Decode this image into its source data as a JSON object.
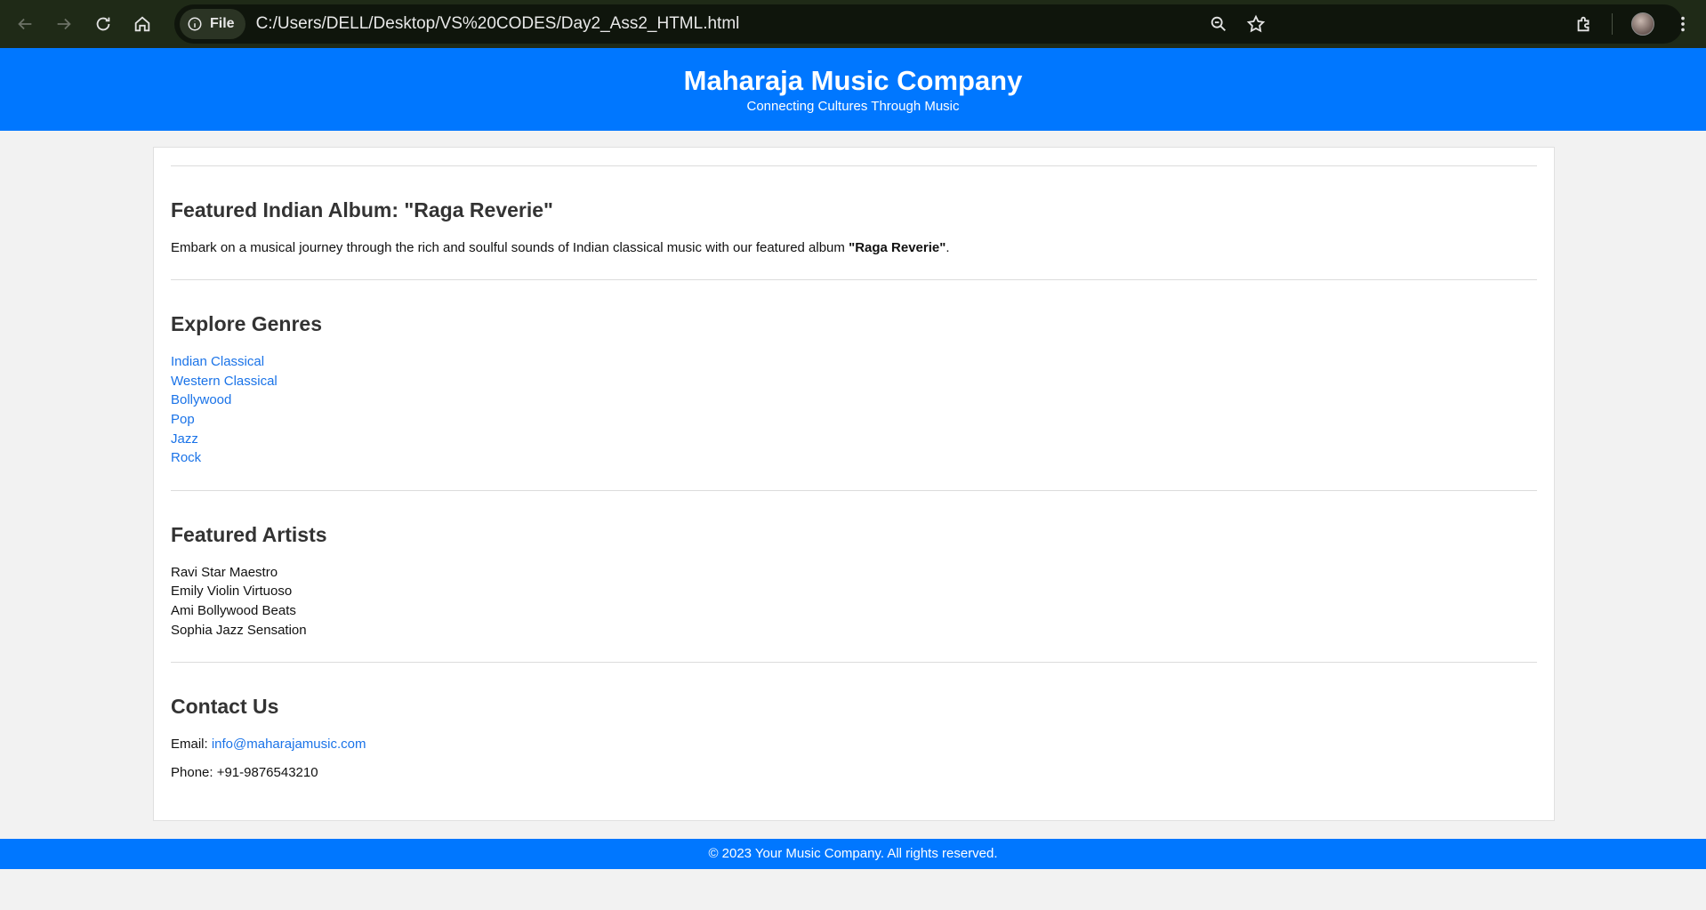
{
  "browser": {
    "chip_label": "File",
    "url": "C:/Users/DELL/Desktop/VS%20CODES/Day2_Ass2_HTML.html"
  },
  "header": {
    "title": "Maharaja Music Company",
    "tagline": "Connecting Cultures Through Music"
  },
  "album": {
    "title": "Featured Indian Album: \"Raga Reverie\"",
    "text_before": "Embark on a musical journey through the rich and soulful sounds of Indian classical music with our featured album ",
    "album_name": "\"Raga Reverie\"",
    "text_after": "."
  },
  "genres": {
    "title": "Explore Genres",
    "items": [
      "Indian Classical",
      "Western Classical",
      "Bollywood",
      "Pop",
      "Jazz",
      "Rock"
    ]
  },
  "artists": {
    "title": "Featured Artists",
    "items": [
      "Ravi Star Maestro",
      "Emily Violin Virtuoso",
      "Ami Bollywood Beats",
      "Sophia Jazz Sensation"
    ]
  },
  "contact": {
    "title": "Contact Us",
    "email_label": "Email: ",
    "email": "info@maharajamusic.com",
    "phone": "Phone: +91-9876543210"
  },
  "footer": {
    "text": "© 2023 Your Music Company. All rights reserved."
  }
}
